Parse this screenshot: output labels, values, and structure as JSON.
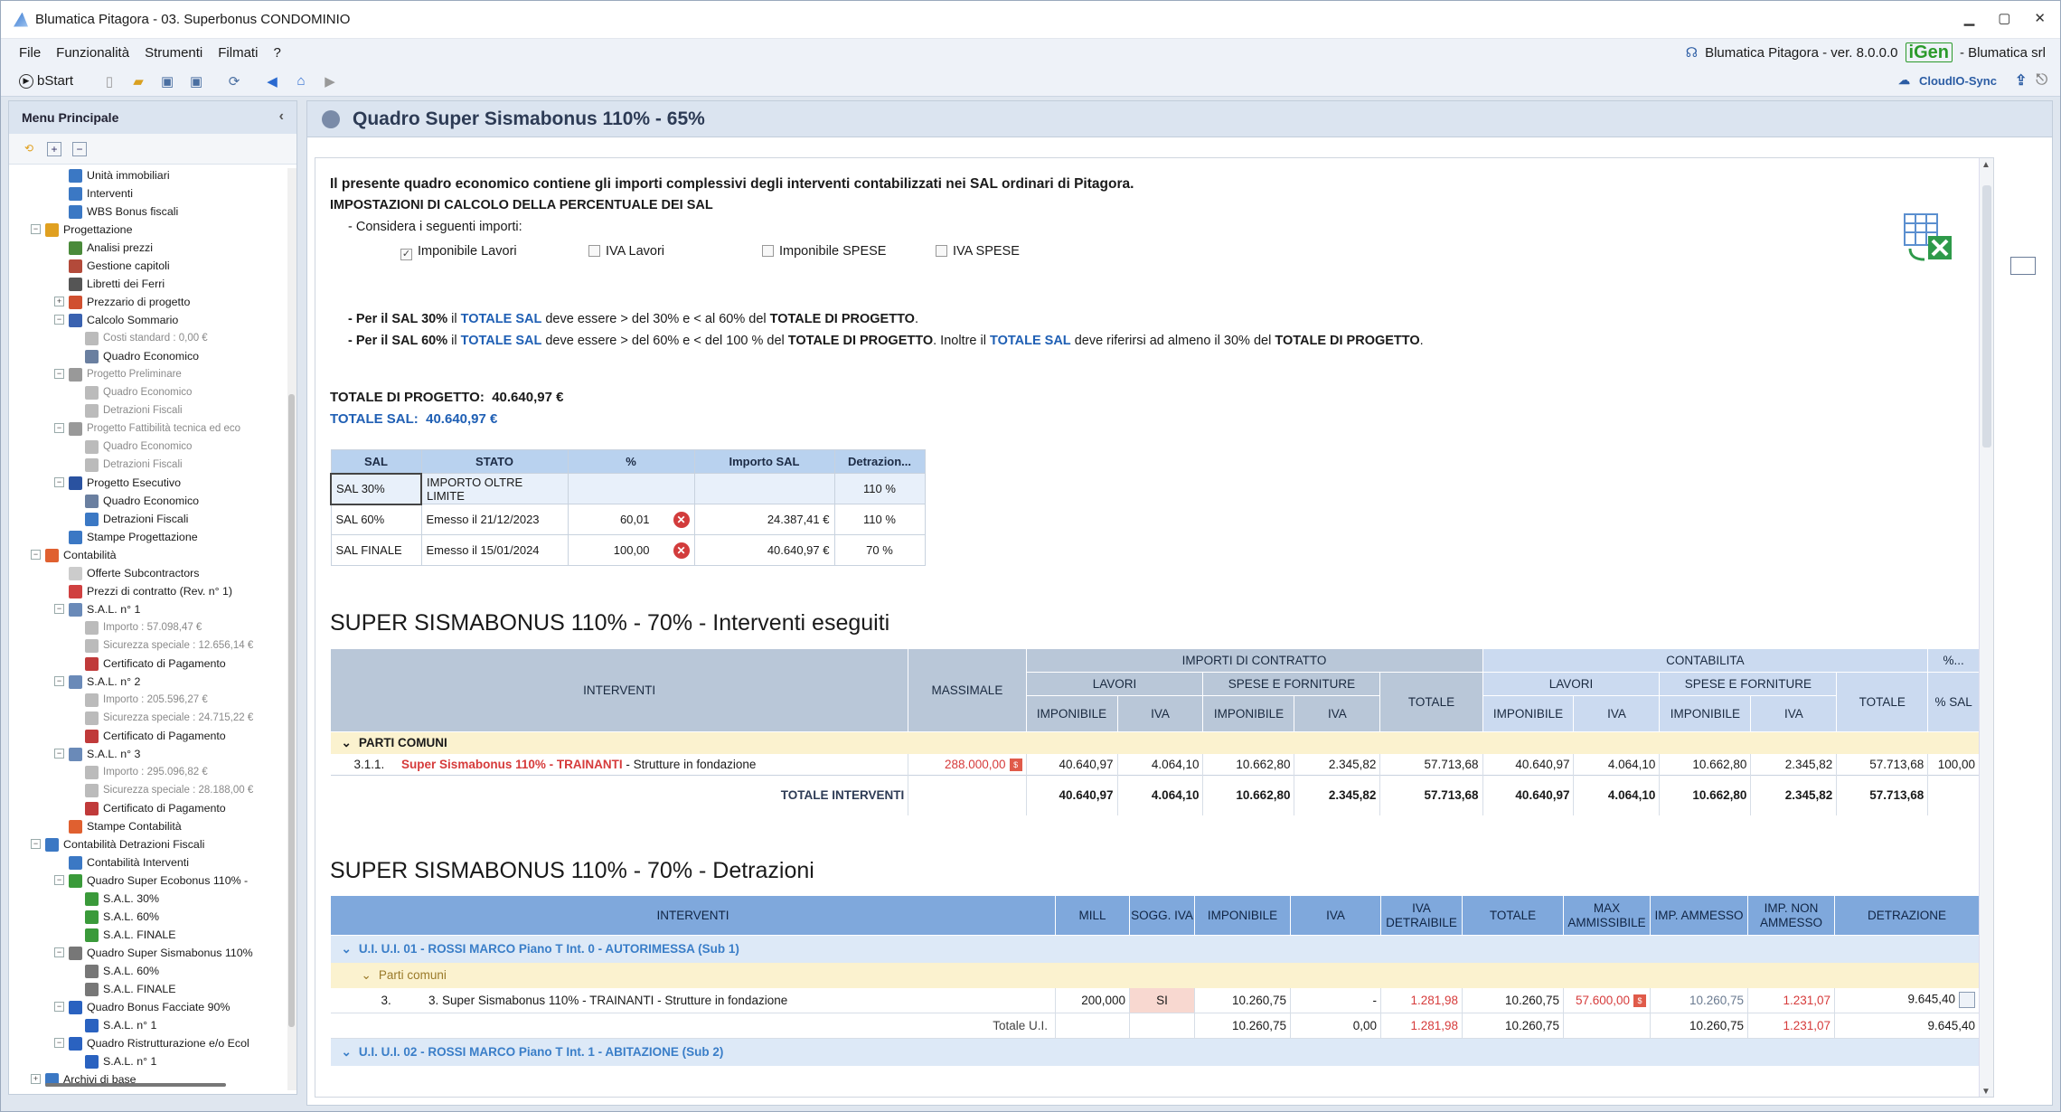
{
  "window": {
    "title": "Blumatica Pitagora - 03. Superbonus CONDOMINIO",
    "controls": [
      "▁",
      "▢",
      "✕"
    ]
  },
  "menu": {
    "items": [
      "File",
      "Funzionalità",
      "Strumenti",
      "Filmati",
      "?"
    ],
    "product": "Blumatica Pitagora - ver. 8.0.0.0",
    "brand": "iGen",
    "company": "- Blumatica srl"
  },
  "toolbar": {
    "start": "bStart",
    "cloud": "CloudIO-Sync"
  },
  "sidebar": {
    "title": "Menu Principale",
    "items": [
      {
        "label": "Unità immobiliari",
        "lvl": 3,
        "color": "#3b78c4"
      },
      {
        "label": "Interventi",
        "lvl": 3,
        "color": "#3b78c4"
      },
      {
        "label": "WBS Bonus fiscali",
        "lvl": 3,
        "color": "#3b78c4"
      },
      {
        "label": "Progettazione",
        "lvl": 2,
        "color": "#e0a020",
        "exp": "−"
      },
      {
        "label": "Analisi prezzi",
        "lvl": 3,
        "color": "#4a8a3a"
      },
      {
        "label": "Gestione capitoli",
        "lvl": 3,
        "color": "#b34a3a"
      },
      {
        "label": "Libretti dei Ferri",
        "lvl": 3,
        "color": "#555"
      },
      {
        "label": "Prezzario di progetto",
        "lvl": 3,
        "color": "#d05030",
        "exp": "+"
      },
      {
        "label": "Calcolo Sommario",
        "lvl": 3,
        "color": "#3a62b0",
        "exp": "−"
      },
      {
        "label": "Costi standard : 0,00 €",
        "lvl": 4,
        "color": "#bbb",
        "gray": true
      },
      {
        "label": "Quadro Economico",
        "lvl": 4,
        "color": "#6a7fa0"
      },
      {
        "label": "Progetto Preliminare",
        "lvl": 3,
        "color": "#999",
        "gray": true,
        "exp": "−"
      },
      {
        "label": "Quadro Economico",
        "lvl": 4,
        "color": "#bbb",
        "gray": true
      },
      {
        "label": "Detrazioni Fiscali",
        "lvl": 4,
        "color": "#bbb",
        "gray": true
      },
      {
        "label": "Progetto Fattibilità tecnica ed eco",
        "lvl": 3,
        "color": "#999",
        "gray": true,
        "exp": "−"
      },
      {
        "label": "Quadro Economico",
        "lvl": 4,
        "color": "#bbb",
        "gray": true
      },
      {
        "label": "Detrazioni Fiscali",
        "lvl": 4,
        "color": "#bbb",
        "gray": true
      },
      {
        "label": "Progetto Esecutivo",
        "lvl": 3,
        "color": "#2a52a0",
        "exp": "−"
      },
      {
        "label": "Quadro Economico",
        "lvl": 4,
        "color": "#6a7fa0"
      },
      {
        "label": "Detrazioni Fiscali",
        "lvl": 4,
        "color": "#3b78c4"
      },
      {
        "label": "Stampe Progettazione",
        "lvl": 3,
        "color": "#3b78c4"
      },
      {
        "label": "Contabilità",
        "lvl": 2,
        "color": "#e06030",
        "exp": "−"
      },
      {
        "label": "Offerte Subcontractors",
        "lvl": 3,
        "color": "#ccc"
      },
      {
        "label": "Prezzi di contratto (Rev. n° 1)",
        "lvl": 3,
        "color": "#d04040"
      },
      {
        "label": "S.A.L. n° 1",
        "lvl": 3,
        "color": "#6a8ab8",
        "exp": "−"
      },
      {
        "label": "Importo : 57.098,47 €",
        "lvl": 4,
        "color": "#bbb",
        "gray": true
      },
      {
        "label": "Sicurezza speciale : 12.656,14 €",
        "lvl": 4,
        "color": "#bbb",
        "gray": true
      },
      {
        "label": "Certificato di Pagamento",
        "lvl": 4,
        "color": "#c03a3a"
      },
      {
        "label": "S.A.L. n° 2",
        "lvl": 3,
        "color": "#6a8ab8",
        "exp": "−"
      },
      {
        "label": "Importo : 205.596,27 €",
        "lvl": 4,
        "color": "#bbb",
        "gray": true
      },
      {
        "label": "Sicurezza speciale : 24.715,22 €",
        "lvl": 4,
        "color": "#bbb",
        "gray": true
      },
      {
        "label": "Certificato di Pagamento",
        "lvl": 4,
        "color": "#c03a3a"
      },
      {
        "label": "S.A.L. n° 3",
        "lvl": 3,
        "color": "#6a8ab8",
        "exp": "−"
      },
      {
        "label": "Importo : 295.096,82 €",
        "lvl": 4,
        "color": "#bbb",
        "gray": true
      },
      {
        "label": "Sicurezza speciale : 28.188,00 €",
        "lvl": 4,
        "color": "#bbb",
        "gray": true
      },
      {
        "label": "Certificato di Pagamento",
        "lvl": 4,
        "color": "#c03a3a"
      },
      {
        "label": "Stampe Contabilità",
        "lvl": 3,
        "color": "#e06030"
      },
      {
        "label": "Contabilità Detrazioni Fiscali",
        "lvl": 2,
        "color": "#3b78c4",
        "exp": "−"
      },
      {
        "label": "Contabilità Interventi",
        "lvl": 3,
        "color": "#3b78c4"
      },
      {
        "label": "Quadro Super Ecobonus 110% -",
        "lvl": 3,
        "color": "#3a9a3a",
        "exp": "−"
      },
      {
        "label": "S.A.L. 30%",
        "lvl": 4,
        "color": "#3a9a3a"
      },
      {
        "label": "S.A.L. 60%",
        "lvl": 4,
        "color": "#3a9a3a"
      },
      {
        "label": "S.A.L. FINALE",
        "lvl": 4,
        "color": "#3a9a3a"
      },
      {
        "label": "Quadro Super Sismabonus 110%",
        "lvl": 3,
        "color": "#777",
        "exp": "−"
      },
      {
        "label": "S.A.L. 60%",
        "lvl": 4,
        "color": "#777"
      },
      {
        "label": "S.A.L. FINALE",
        "lvl": 4,
        "color": "#777"
      },
      {
        "label": "Quadro Bonus Facciate 90%",
        "lvl": 3,
        "color": "#2a62c0",
        "exp": "−"
      },
      {
        "label": "S.A.L. n° 1",
        "lvl": 4,
        "color": "#2a62c0"
      },
      {
        "label": "Quadro Ristrutturazione e/o Ecol",
        "lvl": 3,
        "color": "#2a62c0",
        "exp": "−"
      },
      {
        "label": "S.A.L. n° 1",
        "lvl": 4,
        "color": "#2a62c0"
      },
      {
        "label": "Archivi di base",
        "lvl": 2,
        "color": "#3b78c4",
        "exp": "+"
      }
    ]
  },
  "page": {
    "title": "Quadro Super Sismabonus 110% - 65%",
    "intro": "Il presente quadro economico contiene gli importi complessivi degli interventi contabilizzati nei SAL ordinari di Pitagora.",
    "settings_title": "IMPOSTAZIONI DI CALCOLO DELLA PERCENTUALE DEI SAL",
    "consider": "- Considera i seguenti importi:",
    "checks": [
      {
        "label": "Imponibile Lavori",
        "checked": true
      },
      {
        "label": "IVA Lavori",
        "checked": false
      },
      {
        "label": "Imponibile SPESE",
        "checked": false
      },
      {
        "label": "IVA SPESE",
        "checked": false
      }
    ],
    "rule1": {
      "a": "- Per il SAL 30%",
      "b": " il ",
      "c": "TOTALE SAL",
      "d": " deve essere > del 30% e < al 60% del ",
      "e": "TOTALE DI PROGETTO",
      "f": "."
    },
    "rule2": {
      "a": "- Per il SAL 60%",
      "b": " il ",
      "c": "TOTALE SAL",
      "d": " deve essere > del 60% e < del 100 % del ",
      "e": "TOTALE DI PROGETTO",
      "f": ". Inoltre il ",
      "g": "TOTALE SAL",
      "h": " deve riferirsi ad almeno il 30% del ",
      "i": "TOTALE DI PROGETTO",
      "j": "."
    },
    "tot_prog_label": "TOTALE DI PROGETTO:",
    "tot_prog": "40.640,97 €",
    "tot_sal_label": "TOTALE SAL:",
    "tot_sal": "40.640,97 €"
  },
  "sal_table": {
    "headers": [
      "SAL",
      "STATO",
      "%",
      "Importo SAL",
      "Detrazion..."
    ],
    "rows": [
      {
        "sal": "SAL 30%",
        "stato": "IMPORTO OLTRE LIMITE",
        "pct": "",
        "x": false,
        "importo": "",
        "detr": "110 %"
      },
      {
        "sal": "SAL 60%",
        "stato": "Emesso il 21/12/2023",
        "pct": "60,01",
        "x": true,
        "importo": "24.387,41 €",
        "detr": "110 %"
      },
      {
        "sal": "SAL FINALE",
        "stato": "Emesso il 15/01/2024",
        "pct": "100,00",
        "x": true,
        "importo": "40.640,97 €",
        "detr": "70 %"
      }
    ]
  },
  "interventi": {
    "title": "SUPER SISMABONUS 110% - 70% - Interventi eseguiti",
    "h": {
      "interventi": "INTERVENTI",
      "massimale": "MASSIMALE",
      "importi": "IMPORTI DI CONTRATTO",
      "contab": "CONTABILITA",
      "pct": "%...",
      "lavori": "LAVORI",
      "spese": "SPESE E FORNITURE",
      "totale": "TOTALE",
      "imp": "IMPONIBILE",
      "iva": "IVA",
      "psal": "% SAL"
    },
    "group": "PARTI COMUNI",
    "row": {
      "code": "3.1.1.",
      "name_red": "Super Sismabonus 110% - TRAINANTI",
      "name": " - Strutture in fondazione",
      "massimale": "288.000,00",
      "badge": "$",
      "v": [
        "40.640,97",
        "4.064,10",
        "10.662,80",
        "2.345,82",
        "57.713,68",
        "40.640,97",
        "4.064,10",
        "10.662,80",
        "2.345,82",
        "57.713,68",
        "100,00"
      ]
    },
    "total_label": "TOTALE INTERVENTI",
    "totals": [
      "40.640,97",
      "4.064,10",
      "10.662,80",
      "2.345,82",
      "57.713,68",
      "40.640,97",
      "4.064,10",
      "10.662,80",
      "2.345,82",
      "57.713,68"
    ]
  },
  "detrazioni": {
    "title": "SUPER SISMABONUS 110% - 70% - Detrazioni",
    "headers": [
      "INTERVENTI",
      "MILL",
      "SOGG. IVA",
      "IMPONIBILE",
      "IVA",
      "IVA DETRAIBILE",
      "TOTALE",
      "MAX AMMISSIBILE",
      "IMP. AMMESSO",
      "IMP. NON AMMESSO",
      "DETRAZIONE"
    ],
    "ui1": "U.I. U.I. 01 -  ROSSI MARCO Piano T Int. 0 - AUTORIMESSA (Sub 1)",
    "pc": "Parti comuni",
    "row": {
      "n": "3.",
      "name": "3. Super Sismabonus 110% - TRAINANTI - Strutture in fondazione",
      "mill": "200,000",
      "sogg": "SI",
      "imp": "10.260,75",
      "iva": "-",
      "ivad": "1.281,98",
      "tot": "10.260,75",
      "max": "57.600,00",
      "ammesso": "10.260,75",
      "nonamm": "1.231,07",
      "detr": "9.645,40"
    },
    "tot_label": "Totale U.I.",
    "tot": {
      "imp": "10.260,75",
      "iva": "0,00",
      "ivad": "1.281,98",
      "tot": "10.260,75",
      "ammesso": "10.260,75",
      "nonamm": "1.231,07",
      "detr": "9.645,40"
    },
    "ui2": "U.I. U.I. 02 -  ROSSI MARCO Piano T Int. 1 - ABITAZIONE (Sub 2)"
  }
}
